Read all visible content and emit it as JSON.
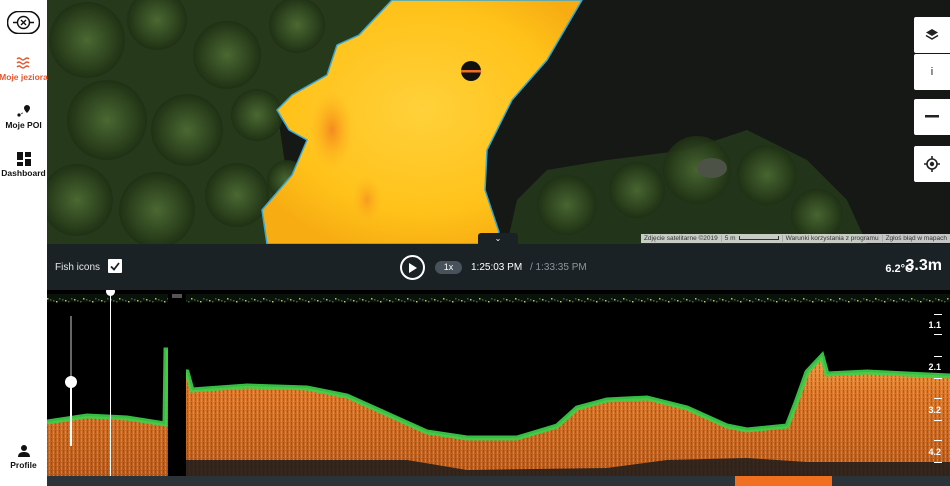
{
  "sidebar": {
    "logo_icon": "compass-logo-icon",
    "items": [
      {
        "label": "Moje jeziora",
        "icon": "waves-icon",
        "active": true
      },
      {
        "label": "Moje POI",
        "icon": "route-pin-icon",
        "active": false
      },
      {
        "label": "Dashboard",
        "icon": "grid-icon",
        "active": false
      }
    ],
    "profile": {
      "label": "Profile",
      "icon": "person-icon"
    }
  },
  "map": {
    "controls": [
      {
        "name": "layers",
        "icon": "layers-icon"
      },
      {
        "name": "info",
        "icon": "info-icon",
        "label": "i"
      },
      {
        "name": "zoom-out",
        "icon": "minus-icon"
      },
      {
        "name": "locate",
        "icon": "locate-icon"
      }
    ],
    "attribution": {
      "imagery": "Zdjęcie satelitarne ©2019",
      "scale": "5 m",
      "terms": "Warunki korzystania z programu",
      "report": "Zgłoś błąd w mapach"
    },
    "collapse_icon": "chevron-down-icon",
    "collapse_glyph": "⌄"
  },
  "playback": {
    "fish_icons_label": "Fish icons",
    "fish_icons_checked": true,
    "speed": "1x",
    "current_time": "1:25:03 PM",
    "total_time": "/ 1:33:35 PM",
    "temperature": "6.2°C",
    "depth": "3.3m"
  },
  "sonar": {
    "depth_scale": [
      "1.1",
      "2.1",
      "3.2",
      "4.2"
    ],
    "gain_level": 0.5,
    "cursor_position": 0.07
  },
  "timeline": {
    "position": 0.76
  },
  "colors": {
    "accent": "#e4572e",
    "toolbar_bg": "#1a2226",
    "sonar_bottom": "#d9762a",
    "sonar_edge": "#3cd24a",
    "map_contour": "#ffc21a",
    "scrubber_thumb": "#f06f21"
  }
}
